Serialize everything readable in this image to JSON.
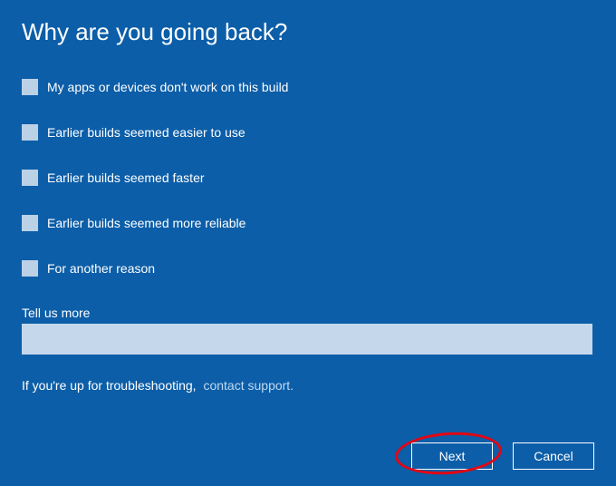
{
  "title": "Why are you going back?",
  "options": [
    {
      "label": "My apps or devices don't work on this build"
    },
    {
      "label": "Earlier builds seemed easier to use"
    },
    {
      "label": "Earlier builds seemed faster"
    },
    {
      "label": "Earlier builds seemed more reliable"
    },
    {
      "label": "For another reason"
    }
  ],
  "tell_more_label": "Tell us more",
  "tell_more_value": "",
  "troubleshoot_text": "If you're up for troubleshooting,",
  "troubleshoot_link": "contact support.",
  "buttons": {
    "next": "Next",
    "cancel": "Cancel"
  }
}
